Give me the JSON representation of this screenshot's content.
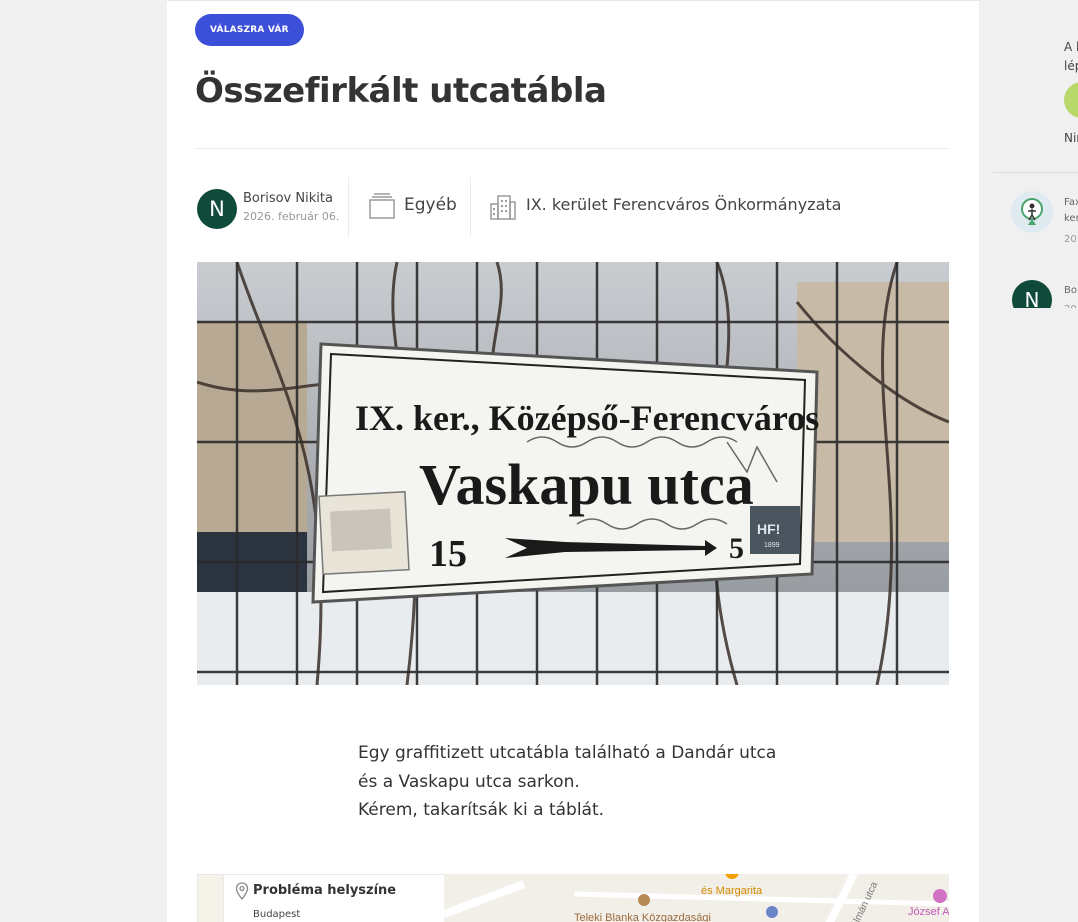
{
  "issue": {
    "status": "VÁLASZRA VÁR",
    "title": "Összefirkált utcatábla",
    "author": {
      "initial": "N",
      "name": "Borisov Nikita",
      "date": "2026. február 06."
    },
    "category": {
      "label": "Egyéb",
      "icon": "folder-stack-icon"
    },
    "organization": {
      "label": "IX. kerület Ferencváros Önkormányzata",
      "icon": "building-icon"
    },
    "photo": {
      "sign_line1": "IX. ker., Középső-Ferencváros",
      "sign_line2": "Vaskapu utca",
      "sign_from": "15",
      "sign_to": "5",
      "sticker_text": "HF!",
      "sticker_year": "1899"
    },
    "description": [
      "Egy graffitizett utcatábla található a Dandár utca",
      "és a Vaskapu utca sarkon.",
      "Kérem, takarítsák ki a táblát."
    ]
  },
  "location": {
    "title": "Probléma helyszíne",
    "city": "Budapest",
    "map_labels": {
      "poi1": "és Margarita",
      "poi2": "Teleki Blanka Közgazdasági",
      "street1": "Kálmán utca",
      "poi3": "József A"
    }
  },
  "right_panel": {
    "text1": "A l",
    "text2": "lép",
    "text3": "Nin",
    "activity1": {
      "line1": "Fax",
      "line2": "ker",
      "line3": "20"
    },
    "activity2": {
      "initial": "N",
      "line1": "Bo",
      "line2": "20"
    }
  }
}
